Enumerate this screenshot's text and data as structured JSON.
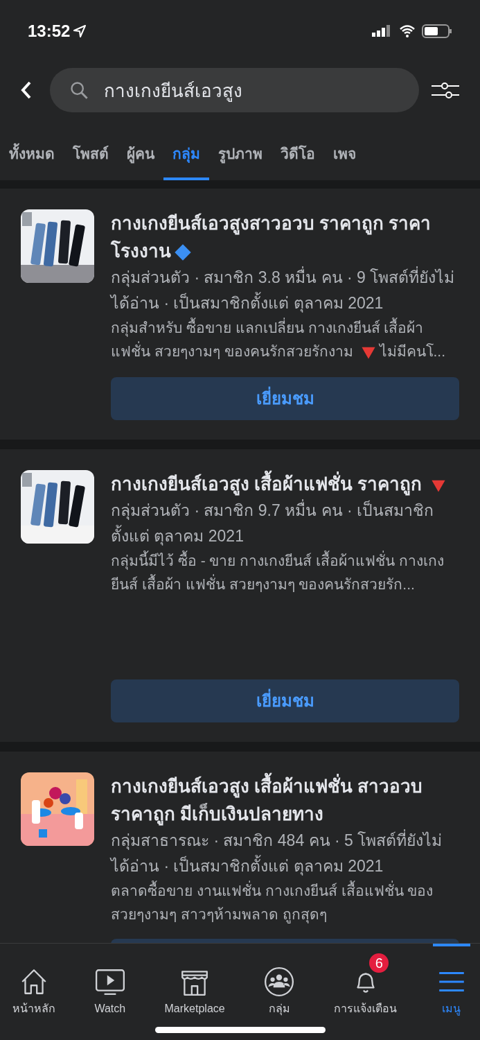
{
  "status_bar": {
    "time": "13:52"
  },
  "search": {
    "value": "กางเกงยีนส์เอวสูง"
  },
  "tabs": [
    {
      "label": "ทั้งหมด",
      "selected": false
    },
    {
      "label": "โพสต์",
      "selected": false
    },
    {
      "label": "ผู้คน",
      "selected": false
    },
    {
      "label": "กลุ่ม",
      "selected": true
    },
    {
      "label": "รูปภาพ",
      "selected": false
    },
    {
      "label": "วิดีโอ",
      "selected": false
    },
    {
      "label": "เพจ",
      "selected": false
    }
  ],
  "groups": [
    {
      "thumbnail": {
        "kind": "picture"
      },
      "title": [
        {
          "kind": "text",
          "text": "กางเกงยีนส์เอวสูงสาวอวบ ราคาถูก ราคาโรงงาน"
        },
        {
          "kind": "diamond"
        }
      ],
      "meta": "กลุ่มส่วนตัว · สมาชิก 3.8 หมื่น คน · 9 โพสต์ที่ยังไม่ได้อ่าน · เป็นสมาชิกตั้งแต่ ตุลาคม  2021",
      "description": [
        {
          "kind": "text",
          "text": "กลุ่มสำหรับ ซื้อขาย แลกเปลี่ยน กางเกงยีนส์ เสื้อผ้าแฟชั่น สวยๆงามๆ ของคนรักสวยรักงาม "
        },
        {
          "kind": "down-triangle"
        },
        {
          "kind": "text",
          "text": "ไม่มีคนโ..."
        }
      ],
      "button": "เยี่ยมชม"
    },
    {
      "thumbnail": {
        "kind": "picture"
      },
      "title": [
        {
          "kind": "text",
          "text": "กางเกงยีนส์เอวสูง เสื้อผ้าแฟชั่น ราคาถูก "
        },
        {
          "kind": "down-triangle"
        }
      ],
      "meta": "กลุ่มส่วนตัว · สมาชิก 9.7 หมื่น คน · เป็นสมาชิกตั้งแต่ ตุลาคม  2021",
      "description": [
        {
          "kind": "text",
          "text": "กลุ่มนี้มีไว้ ซื้อ - ขาย กางเกงยีนส์ เสื้อผ้าแฟชั่น กางเกงยีนส์ เสื้อผ้า แฟชั่น สวยๆงามๆ ของคนรักสวยรัก..."
        }
      ],
      "button": "เยี่ยมชม"
    },
    {
      "thumbnail": {
        "kind": "picture"
      },
      "title": [
        {
          "kind": "text",
          "text": "กางเกงยีนส์เอวสูง เสื้อผ้าแฟชั่น สาวอวบ ราคาถูก มีเก็บเงินปลายทาง"
        }
      ],
      "meta": "กลุ่มสาธารณะ · สมาชิก 484 คน · 5 โพสต์ที่ยังไม่ได้อ่าน · เป็นสมาชิกตั้งแต่ ตุลาคม  2021",
      "description": [
        {
          "kind": "text",
          "text": "ตลาดซื้อขาย งานแฟชั่น กางเกงยีนส์ เสื้อแฟชั่น ของสวยๆงามๆ สาวๆห้ามพลาด ถูกสุดๆ"
        }
      ]
    }
  ],
  "bottom_nav": [
    {
      "kind": "home",
      "label": "หน้าหลัก",
      "selected": false
    },
    {
      "kind": "watch",
      "label": "Watch",
      "selected": false
    },
    {
      "kind": "store",
      "label": "Marketplace",
      "selected": false
    },
    {
      "kind": "groups",
      "label": "กลุ่ม",
      "selected": false
    },
    {
      "kind": "bell",
      "label": "การแจ้งเตือน",
      "selected": false,
      "badge": "6"
    },
    {
      "kind": "menu",
      "label": "เมนู",
      "selected": true
    }
  ]
}
